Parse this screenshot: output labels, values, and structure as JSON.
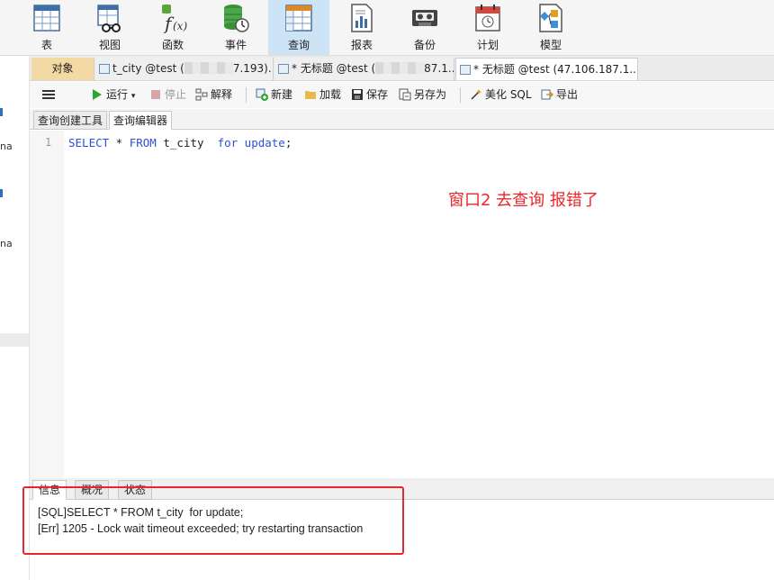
{
  "toolbar": {
    "items": [
      {
        "label": "表",
        "icon": "table-icon"
      },
      {
        "label": "视图",
        "icon": "view-icon"
      },
      {
        "label": "函数",
        "icon": "function-icon"
      },
      {
        "label": "事件",
        "icon": "event-icon"
      },
      {
        "label": "查询",
        "icon": "query-icon",
        "active": true
      },
      {
        "label": "报表",
        "icon": "report-icon"
      },
      {
        "label": "备份",
        "icon": "backup-icon"
      },
      {
        "label": "计划",
        "icon": "schedule-icon"
      },
      {
        "label": "模型",
        "icon": "model-icon"
      }
    ]
  },
  "sidebar": {
    "fragments": [
      "na",
      "na"
    ]
  },
  "tabs": {
    "objects": "对象",
    "tab1_prefix": "t_city @test (",
    "tab1_suffix": "7.193)...",
    "tab2_prefix": "* 无标题 @test (",
    "tab2_suffix": "87.1...",
    "tab3": "* 无标题 @test (47.106.187.1..."
  },
  "actions": {
    "run": "运行",
    "stop": "停止",
    "explain": "解释",
    "new": "新建",
    "load": "加载",
    "save": "保存",
    "save_as": "另存为",
    "beautify": "美化 SQL",
    "export": "导出"
  },
  "subtabs": {
    "builder": "查询创建工具",
    "editor": "查询编辑器"
  },
  "editor": {
    "line_number": "1",
    "kw_select": "SELECT",
    "star": " * ",
    "kw_from": "FROM",
    "table": " t_city  ",
    "kw_for_update": "for update",
    "semi": ";"
  },
  "annotation": "窗口2 去查询 报错了",
  "bottom_tabs": {
    "info": "信息",
    "overview": "概况",
    "status": "状态"
  },
  "messages": {
    "line1": "[SQL]SELECT * FROM t_city  for update;",
    "line2": "[Err] 1205 - Lock wait timeout exceeded; try restarting transaction"
  },
  "colors": {
    "accent": "#cde3f6",
    "keyword": "#2f4fd8",
    "annotation": "#e8272b",
    "objects_tab": "#f3d9a4"
  }
}
